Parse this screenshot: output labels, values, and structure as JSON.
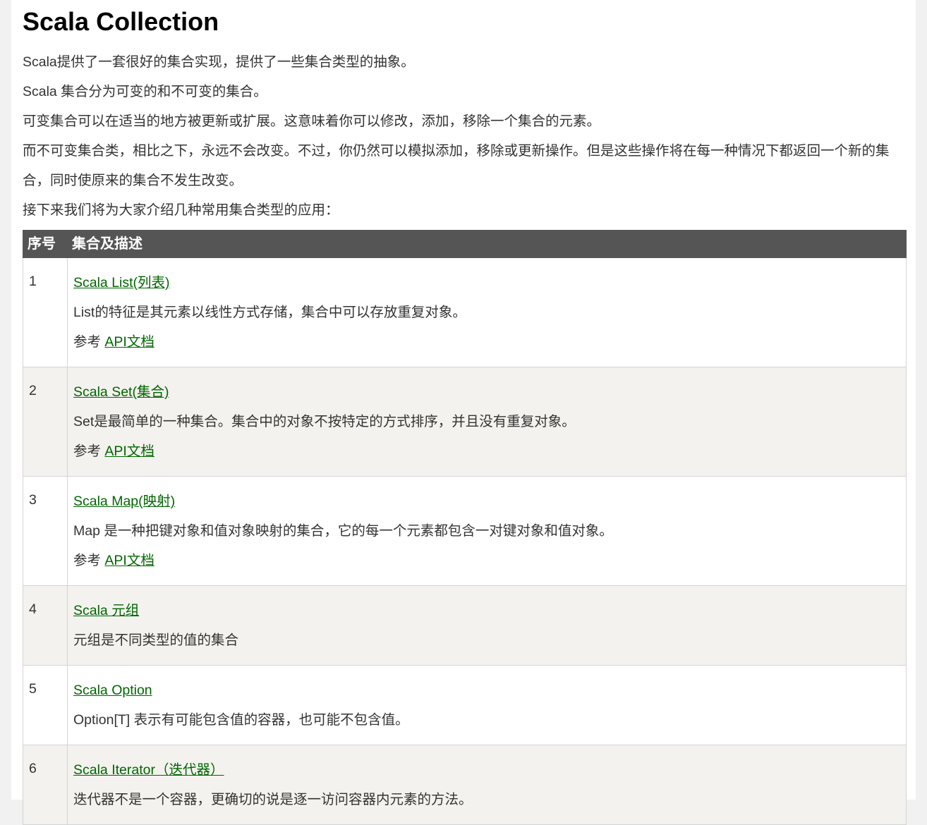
{
  "page_title": "Scala Collection",
  "intro": [
    "Scala提供了一套很好的集合实现，提供了一些集合类型的抽象。",
    "Scala 集合分为可变的和不可变的集合。",
    "可变集合可以在适当的地方被更新或扩展。这意味着你可以修改，添加，移除一个集合的元素。",
    "而不可变集合类，相比之下，永远不会改变。不过，你仍然可以模拟添加，移除或更新操作。但是这些操作将在每一种情况下都返回一个新的集合，同时使原来的集合不发生改变。",
    "接下来我们将为大家介绍几种常用集合类型的应用："
  ],
  "table": {
    "headers": [
      "序号",
      "集合及描述"
    ],
    "rows": [
      {
        "num": "1",
        "link": "Scala List(列表)",
        "desc": "List的特征是其元素以线性方式存储，集合中可以存放重复对象。",
        "ref_prefix": "参考 ",
        "ref_link": "API文档"
      },
      {
        "num": "2",
        "link": "Scala Set(集合)",
        "desc": "Set是最简单的一种集合。集合中的对象不按特定的方式排序，并且没有重复对象。",
        "ref_prefix": "参考 ",
        "ref_link": "API文档"
      },
      {
        "num": "3",
        "link": "Scala Map(映射)",
        "desc": "Map 是一种把键对象和值对象映射的集合，它的每一个元素都包含一对键对象和值对象。",
        "ref_prefix": "参考 ",
        "ref_link": "API文档"
      },
      {
        "num": "4",
        "link": "Scala 元组",
        "desc": "元组是不同类型的值的集合"
      },
      {
        "num": "5",
        "link": "Scala Option",
        "desc": "Option[T] 表示有可能包含值的容器，也可能不包含值。"
      },
      {
        "num": "6",
        "link": "Scala Iterator（迭代器）",
        "desc": "迭代器不是一个容器，更确切的说是逐一访问容器内元素的方法。"
      }
    ]
  },
  "colors": {
    "header_bg": "#555555",
    "link": "#006600",
    "even_row_bg": "#f3f2ee"
  }
}
